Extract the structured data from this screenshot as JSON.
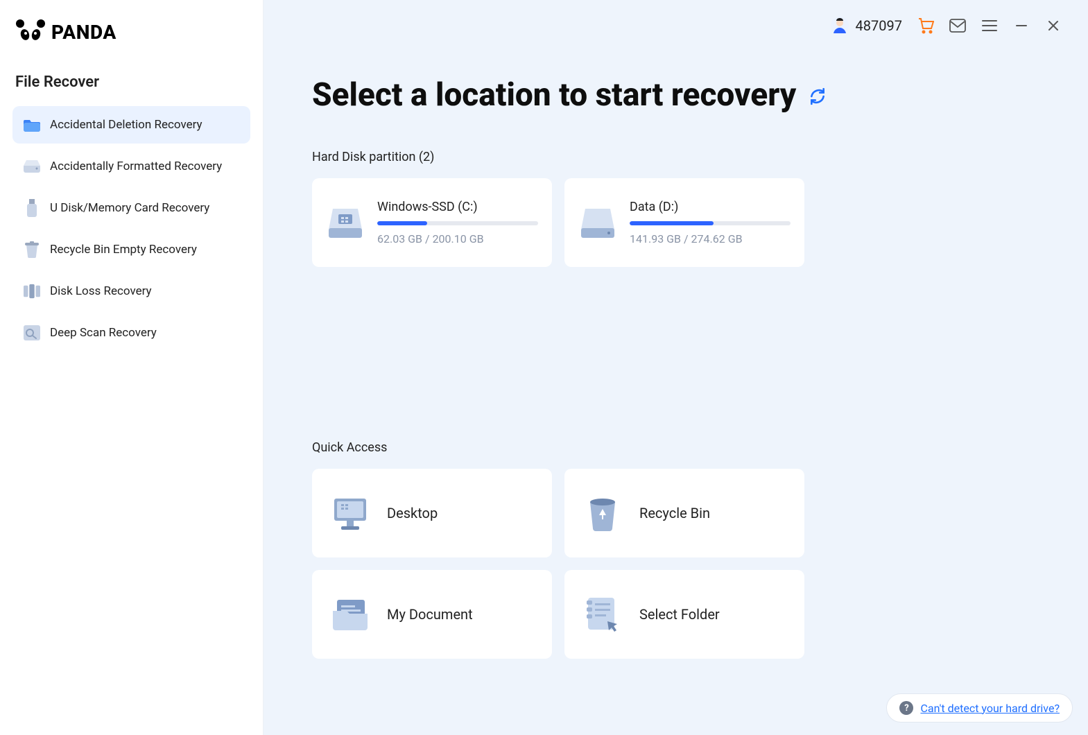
{
  "brand": "PANDA",
  "sidebar": {
    "title": "File Recover",
    "items": [
      {
        "label": "Accidental Deletion Recovery",
        "active": true
      },
      {
        "label": "Accidentally Formatted Recovery",
        "active": false
      },
      {
        "label": "U Disk/Memory Card Recovery",
        "active": false
      },
      {
        "label": "Recycle Bin Empty Recovery",
        "active": false
      },
      {
        "label": "Disk Loss Recovery",
        "active": false
      },
      {
        "label": "Deep Scan Recovery",
        "active": false
      }
    ]
  },
  "topbar": {
    "user_id": "487097"
  },
  "main": {
    "title": "Select a location to start recovery",
    "partitions_label": "Hard Disk partition   (2)",
    "partitions": [
      {
        "name": "Windows-SSD   (C:)",
        "used": "62.03 GB",
        "total": "200.10 GB",
        "size_text": "62.03 GB / 200.10 GB",
        "pct": 31
      },
      {
        "name": "Data   (D:)",
        "used": "141.93 GB",
        "total": "274.62 GB",
        "size_text": "141.93 GB / 274.62 GB",
        "pct": 52
      }
    ],
    "quick_label": "Quick Access",
    "quick": [
      {
        "label": "Desktop"
      },
      {
        "label": "Recycle Bin"
      },
      {
        "label": "My Document"
      },
      {
        "label": "Select Folder"
      }
    ],
    "help_link": "Can't detect your hard drive?"
  }
}
